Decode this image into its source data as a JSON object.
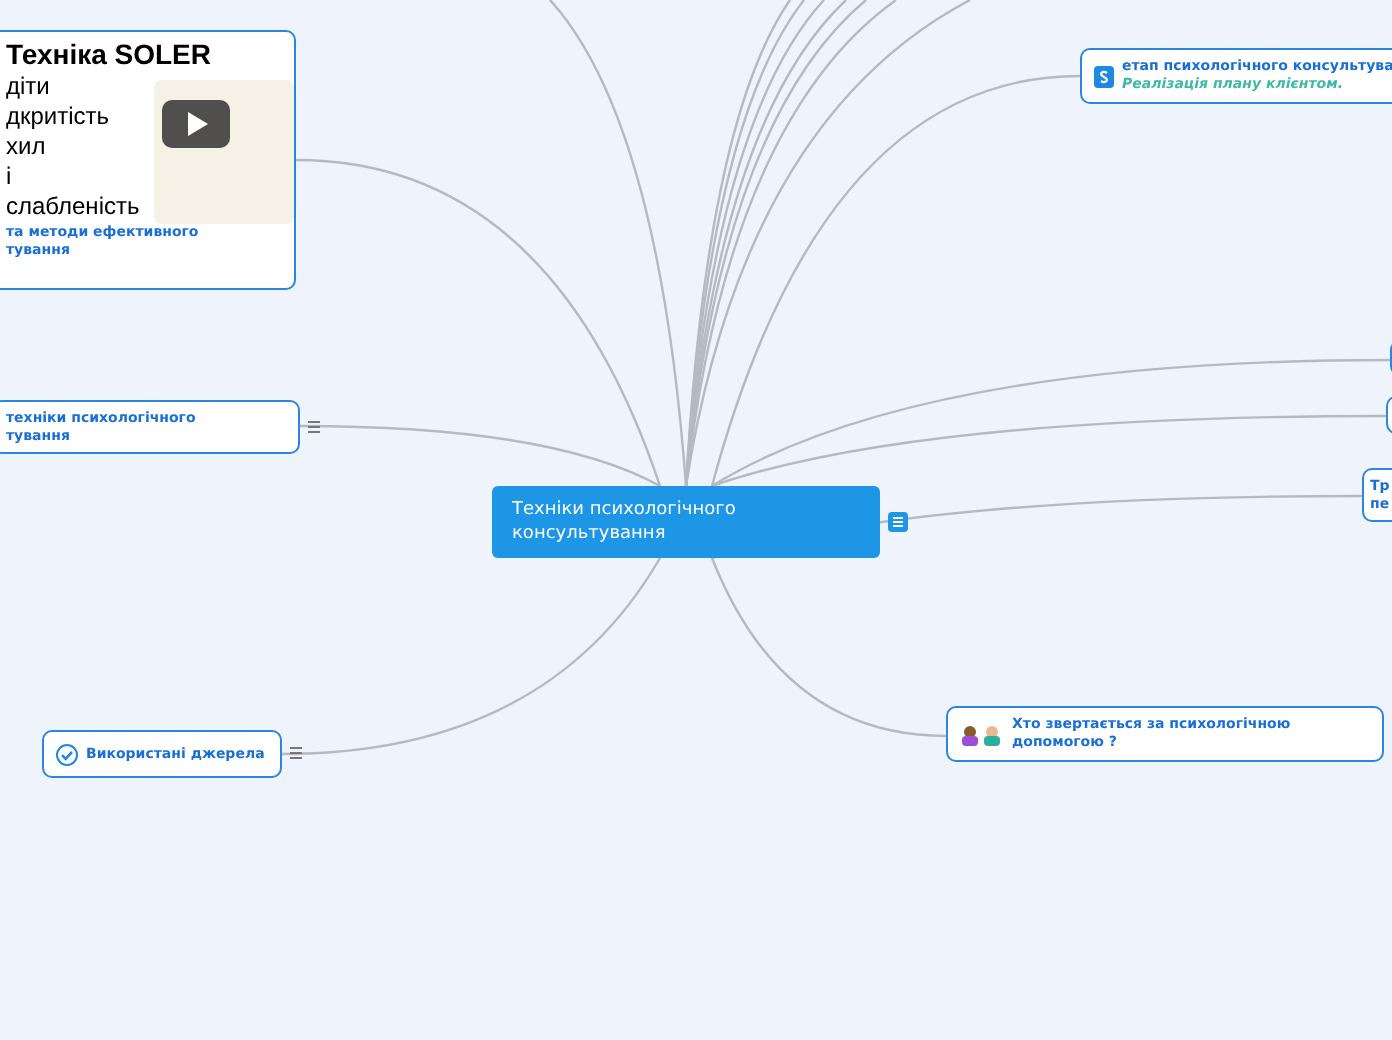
{
  "map": {
    "central": {
      "text": "Техніки психологічного консультування",
      "has_note": true
    },
    "nodes": [
      {
        "kind": "media",
        "title": "Техніка SOLER",
        "list": [
          "діти",
          "дкритість",
          "хил",
          "і",
          "слабленість"
        ],
        "caption_lines": [
          "та методи ефективного",
          "тування"
        ],
        "has_note": false
      },
      {
        "kind": "topic",
        "lines": [
          "техніки психологічного",
          "тування"
        ],
        "has_note": true
      },
      {
        "kind": "topic",
        "lines": [
          "етап психологічного консультува"
        ],
        "subtitle": "Реалізація плану клієнтом.",
        "has_note": false
      },
      {
        "kind": "stub",
        "has_note": false
      },
      {
        "kind": "stub",
        "has_note": false
      },
      {
        "kind": "topic",
        "lines": [
          "Тр",
          "пе"
        ],
        "has_note": false
      },
      {
        "kind": "topic",
        "lines": [
          "Хто звертається за психологічною",
          "допомогою ?"
        ],
        "has_note": false
      },
      {
        "kind": "topic",
        "lines": [
          "Використані джерела"
        ],
        "has_note": true
      }
    ]
  }
}
